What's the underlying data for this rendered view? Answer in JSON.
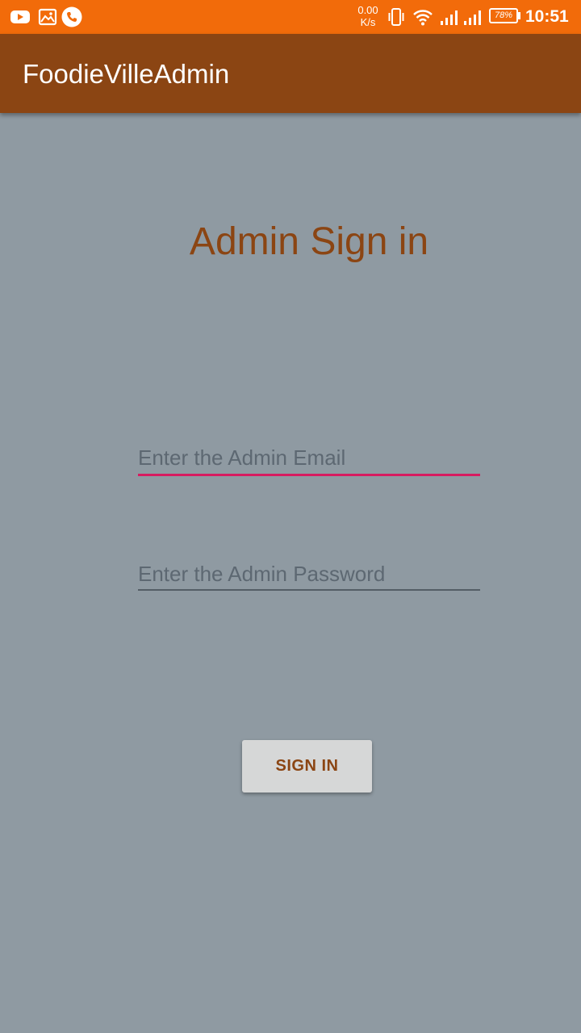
{
  "status_bar": {
    "left_icons": [
      "youtube-icon",
      "gallery-icon",
      "phone-call-icon"
    ],
    "net_speed_value": "0.00",
    "net_speed_unit": "K/s",
    "right_icons": [
      "vibrate-icon",
      "wifi-icon",
      "signal-icon-1",
      "signal-icon-2"
    ],
    "battery_percent": "78%",
    "time": "10:51"
  },
  "app_bar": {
    "title": "FoodieVilleAdmin"
  },
  "main": {
    "title": "Admin Sign in",
    "email_field": {
      "value": "",
      "placeholder": "Enter the Admin Email"
    },
    "password_field": {
      "value": "",
      "placeholder": "Enter the Admin Password"
    },
    "sign_in_label": "SIGN IN"
  },
  "colors": {
    "status_bar": "#f26b0a",
    "app_bar": "#8b4513",
    "background": "#8f9aa2",
    "accent_focused": "#d81b60",
    "title_text": "#8b4513",
    "button_bg": "#d6d7d7"
  }
}
